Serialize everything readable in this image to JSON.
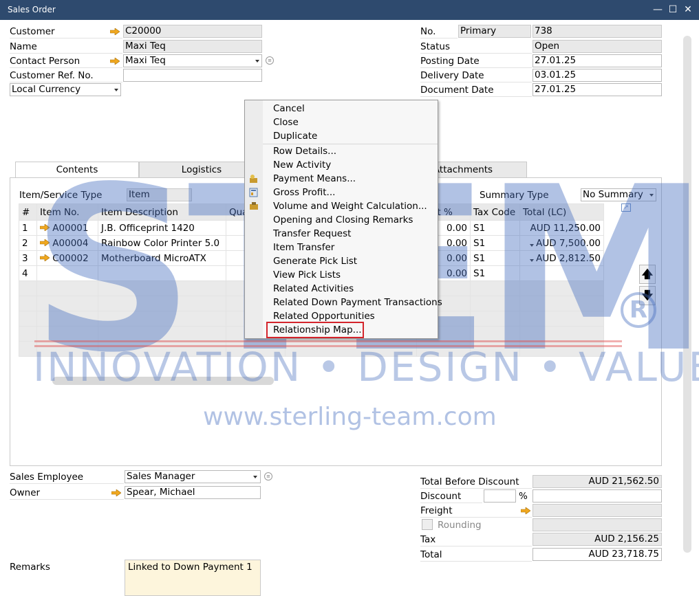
{
  "window": {
    "title": "Sales Order"
  },
  "header_left": {
    "customer_label": "Customer",
    "customer_value": "C20000",
    "name_label": "Name",
    "name_value": "Maxi Teq",
    "contact_label": "Contact Person",
    "contact_value": "Maxi Teq",
    "custref_label": "Customer Ref. No.",
    "custref_value": "",
    "currency_value": "Local Currency"
  },
  "header_right": {
    "no_label": "No.",
    "series_value": "Primary",
    "no_value": "738",
    "status_label": "Status",
    "status_value": "Open",
    "posting_label": "Posting Date",
    "posting_value": "27.01.25",
    "delivery_label": "Delivery Date",
    "delivery_value": "03.01.25",
    "document_label": "Document Date",
    "document_value": "27.01.25"
  },
  "tabs": [
    "Contents",
    "Logistics",
    "Attachments"
  ],
  "contents": {
    "item_type_label": "Item/Service Type",
    "item_type_value": "Item",
    "summary_label": "Summary Type",
    "summary_value": "No Summary",
    "columns": [
      "#",
      "Item No.",
      "Item Description",
      "Qua",
      "ount %",
      "Tax Code",
      "Total (LC)"
    ],
    "rows": [
      {
        "n": "1",
        "item": "A00001",
        "desc": "J.B. Officeprint 1420",
        "disc": "0.00",
        "tax": "S1",
        "total": "AUD 11,250.00"
      },
      {
        "n": "2",
        "item": "A00004",
        "desc": "Rainbow Color Printer 5.0",
        "disc": "0.00",
        "tax": "S1",
        "total": "AUD 7,500.00"
      },
      {
        "n": "3",
        "item": "C00002",
        "desc": "Motherboard MicroATX",
        "disc": "0.00",
        "tax": "S1",
        "total": "AUD 2,812.50"
      },
      {
        "n": "4",
        "item": "",
        "desc": "",
        "disc": "0.00",
        "tax": "S1",
        "total": ""
      }
    ]
  },
  "context_menu": {
    "items": [
      "Cancel",
      "Close",
      "Duplicate",
      "Row Details...",
      "New Activity",
      "Payment Means...",
      "Gross Profit...",
      "Volume and Weight Calculation...",
      "Opening and Closing Remarks",
      "Transfer Request",
      "Item Transfer",
      "Generate Pick List",
      "View Pick Lists",
      "Related Activities",
      "Related Down Payment Transactions",
      "Related Opportunities",
      "Relationship Map..."
    ]
  },
  "footer_left": {
    "sales_emp_label": "Sales Employee",
    "sales_emp_value": "Sales Manager",
    "owner_label": "Owner",
    "owner_value": "Spear, Michael",
    "remarks_label": "Remarks",
    "remarks_value": "Linked to Down Payment 1"
  },
  "footer_right": {
    "tbd_label": "Total Before Discount",
    "tbd_value": "AUD 21,562.50",
    "discount_label": "Discount",
    "discount_pct": "%",
    "freight_label": "Freight",
    "rounding_label": "Rounding",
    "tax_label": "Tax",
    "tax_value": "AUD 2,156.25",
    "total_label": "Total",
    "total_value": "AUD 23,718.75"
  },
  "watermark": {
    "logo": "STEM",
    "tagline": "INNOVATION • DESIGN • VALUE",
    "url": "www.sterling-team.com",
    "reg": "R"
  },
  "colors": {
    "titlebar": "#2e4a6e",
    "highlight": "#d4242b",
    "watermark": "#466ebe",
    "link_arrow": "#f0a820"
  }
}
